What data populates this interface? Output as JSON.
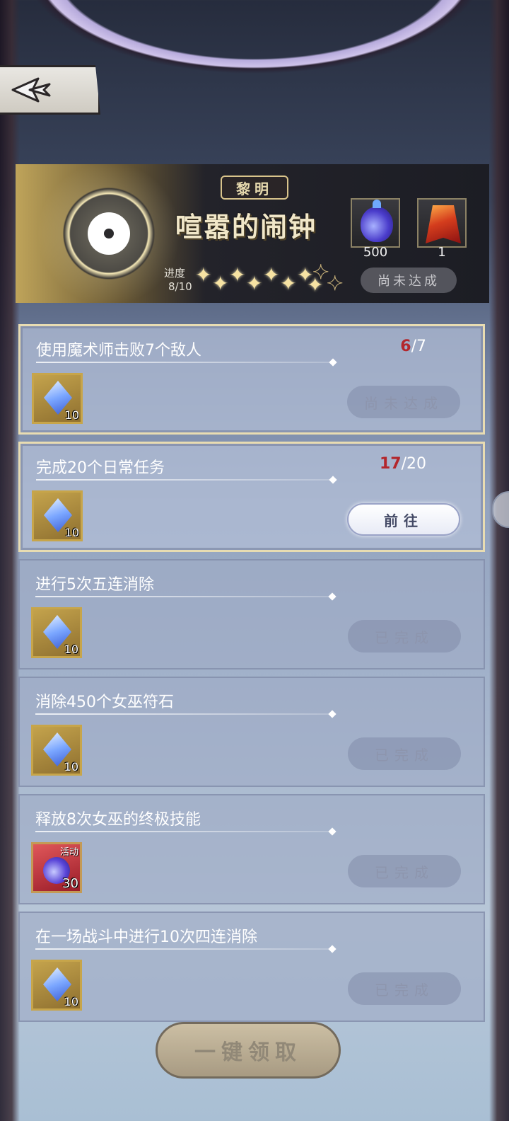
{
  "header": {
    "back_icon": "arrow-left-icon"
  },
  "banner": {
    "subtitle": "黎明",
    "title": "喧嚣的闹钟",
    "progress_label": "进度",
    "progress_value": "8/10",
    "stars_filled": 8,
    "stars_total": 10,
    "rewards": [
      {
        "icon": "mana-potion-icon",
        "count": "500"
      },
      {
        "icon": "red-cape-icon",
        "count": "1"
      }
    ],
    "status": "尚未达成"
  },
  "tasks": [
    {
      "name": "使用魔术师击败7个敌人",
      "current": "6",
      "target": "/7",
      "reward_icon": "blue-crystal-icon",
      "reward_qty": "10",
      "button": "尚未达成",
      "state": "not_reached"
    },
    {
      "name": "完成20个日常任务",
      "current": "17",
      "target": "/20",
      "reward_icon": "blue-crystal-icon",
      "reward_qty": "10",
      "button": "前往",
      "state": "go"
    },
    {
      "name": "进行5次五连消除",
      "current": "",
      "target": "",
      "reward_icon": "blue-crystal-icon",
      "reward_qty": "10",
      "button": "已完成",
      "state": "done"
    },
    {
      "name": "消除450个女巫符石",
      "current": "",
      "target": "",
      "reward_icon": "blue-crystal-icon",
      "reward_qty": "10",
      "button": "已完成",
      "state": "done"
    },
    {
      "name": "释放8次女巫的终极技能",
      "current": "",
      "target": "",
      "reward_icon": "event-potion-icon",
      "reward_tag": "活动",
      "reward_qty": "30",
      "button": "已完成",
      "state": "done"
    },
    {
      "name": "在一场战斗中进行10次四连消除",
      "current": "",
      "target": "",
      "reward_icon": "blue-crystal-icon",
      "reward_qty": "10",
      "button": "已完成",
      "state": "done"
    }
  ],
  "footer": {
    "claim_all": "一键领取"
  }
}
